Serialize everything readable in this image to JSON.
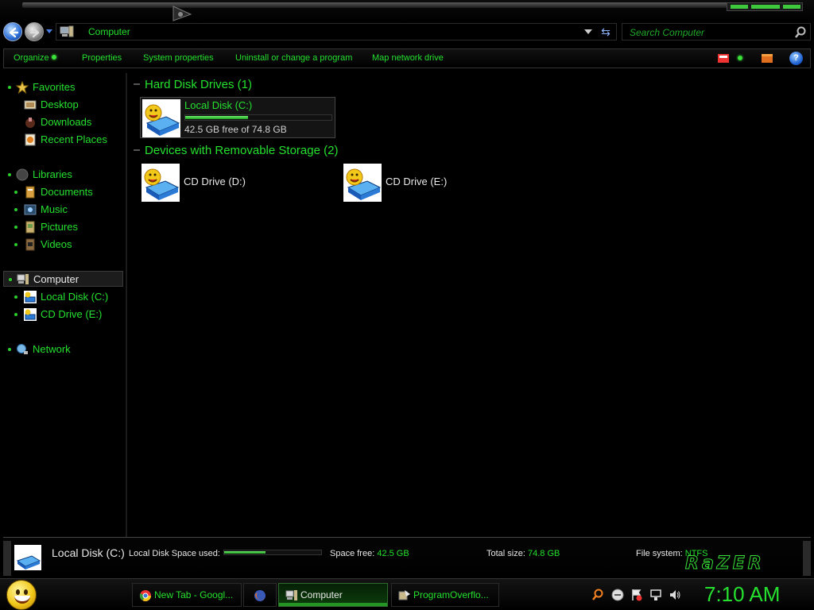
{
  "address": {
    "path": "Computer"
  },
  "search": {
    "placeholder": "Search Computer"
  },
  "toolbar": {
    "organize": "Organize",
    "properties": "Properties",
    "system_properties": "System properties",
    "uninstall": "Uninstall or change a program",
    "map_drive": "Map network drive",
    "help": "?"
  },
  "nav": {
    "favorites": "Favorites",
    "desktop": "Desktop",
    "downloads": "Downloads",
    "recent": "Recent Places",
    "libraries": "Libraries",
    "documents": "Documents",
    "music": "Music",
    "pictures": "Pictures",
    "videos": "Videos",
    "computer": "Computer",
    "local_disk": "Local Disk (C:)",
    "cd_drive": "CD Drive (E:)",
    "network": "Network"
  },
  "content": {
    "hdd_header": "Hard Disk Drives (1)",
    "removable_header": "Devices with Removable Storage (2)",
    "local_disk": {
      "name": "Local Disk (C:)",
      "free_text": "42.5 GB free of 74.8 GB",
      "used_fraction": 0.43
    },
    "cd_d": {
      "name": "CD Drive (D:)"
    },
    "cd_e": {
      "name": "CD Drive (E:)"
    }
  },
  "details": {
    "name": "Local Disk (C:)",
    "space_used_label": "Local Disk Space used:",
    "used_fraction": 0.43,
    "free_label": "Space free:",
    "free_value": "42.5 GB",
    "total_label": "Total size:",
    "total_value": "74.8 GB",
    "fs_label": "File system:",
    "fs_value": "NTFS",
    "brand": "RaZER"
  },
  "taskbar": {
    "tasks": [
      "New Tab - Googl...",
      "",
      "Computer",
      "ProgramOverflo..."
    ],
    "clock": "7:10 AM"
  },
  "colors": {
    "accent": "#25e02f",
    "background": "#000000"
  },
  "icons": [
    "back-arrow-icon",
    "forward-arrow-icon",
    "computer-icon",
    "search-icon",
    "refresh-icon",
    "help-icon",
    "star-icon",
    "drive-icon",
    "chrome-icon",
    "firefox-icon"
  ]
}
